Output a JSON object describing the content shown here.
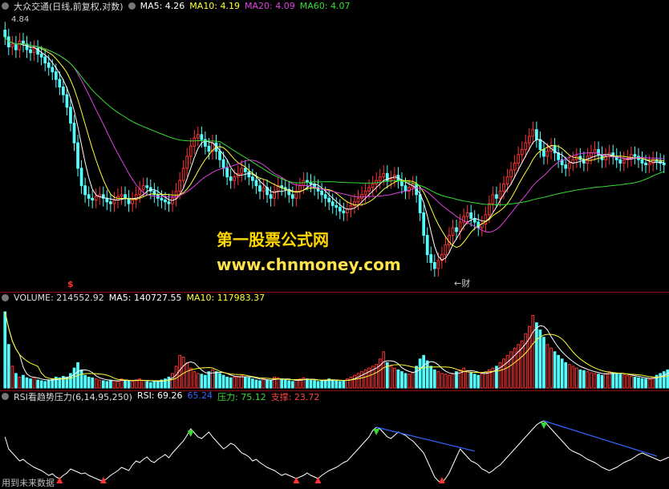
{
  "header": {
    "stock": "大众交通(日线,前复权,对数)",
    "ma": [
      {
        "text": "MA5: 4.26",
        "color": "#ffffff"
      },
      {
        "text": "MA10: 4.19",
        "color": "#ffff33"
      },
      {
        "text": "MA20: 4.09",
        "color": "#e040e0"
      },
      {
        "text": "MA60: 4.07",
        "color": "#33dd33"
      }
    ]
  },
  "volume_header": {
    "items": [
      {
        "text": "VOLUME: 214552.92",
        "color": "#dddddd"
      },
      {
        "text": "MA5: 140727.55",
        "color": "#ffffff"
      },
      {
        "text": "MA10: 117983.37",
        "color": "#ffff33"
      }
    ]
  },
  "rsi_header": {
    "items": [
      {
        "text": "RSI看趋势压力(6,14,95,250)",
        "color": "#dddddd"
      },
      {
        "text": "RSI: 69.26",
        "color": "#ffffff"
      },
      {
        "text": "65.24",
        "color": "#3366ff"
      },
      {
        "text": "压力: 75.12",
        "color": "#33dd33"
      },
      {
        "text": "支撑: 23.72",
        "color": "#ff4444"
      }
    ]
  },
  "annotations": {
    "high_label": "4.84",
    "marker_s": "$",
    "marker_cai": "←财",
    "future_note": "用到未来数据"
  },
  "watermark": {
    "line1": "第一股票公式网",
    "line2": "www.chnmoney.com"
  },
  "colors": {
    "up": "#ff3333",
    "down": "#54ffff",
    "ma5": "#ffffff",
    "ma10": "#ffff33",
    "ma20": "#e040e0",
    "ma60": "#33dd33",
    "rsi": "#ffffff",
    "rsi_trend": "#3366ff",
    "pressure": "#33dd33",
    "buy_arrow": "#ff3333",
    "sell_arrow": "#33dd33"
  },
  "chart_data": {
    "type": "candlestick",
    "price_range": [
      3.35,
      4.95
    ],
    "closes": [
      4.79,
      4.72,
      4.74,
      4.7,
      4.76,
      4.74,
      4.7,
      4.68,
      4.71,
      4.67,
      4.65,
      4.61,
      4.58,
      4.55,
      4.5,
      4.45,
      4.4,
      4.32,
      4.22,
      4.1,
      3.95,
      3.85,
      3.8,
      3.78,
      3.77,
      3.79,
      3.8,
      3.78,
      3.76,
      3.75,
      3.77,
      3.79,
      3.8,
      3.78,
      3.75,
      3.77,
      3.8,
      3.83,
      3.85,
      3.84,
      3.82,
      3.8,
      3.78,
      3.77,
      3.76,
      3.75,
      3.78,
      3.82,
      3.88,
      3.95,
      4.02,
      4.08,
      4.13,
      4.15,
      4.12,
      4.08,
      4.05,
      4.1,
      4.05,
      4.0,
      3.95,
      3.9,
      3.88,
      3.9,
      3.92,
      3.95,
      3.93,
      3.9,
      3.88,
      3.85,
      3.82,
      3.84,
      3.8,
      3.78,
      3.82,
      3.85,
      3.84,
      3.83,
      3.8,
      3.78,
      3.82,
      3.85,
      3.88,
      3.87,
      3.86,
      3.84,
      3.82,
      3.8,
      3.78,
      3.76,
      3.74,
      3.73,
      3.71,
      3.7,
      3.72,
      3.74,
      3.76,
      3.78,
      3.8,
      3.82,
      3.84,
      3.86,
      3.88,
      3.9,
      3.92,
      3.88,
      3.89,
      3.91,
      3.88,
      3.85,
      3.82,
      3.84,
      3.86,
      3.8,
      3.7,
      3.58,
      3.48,
      3.44,
      3.41,
      3.45,
      3.48,
      3.53,
      3.58,
      3.62,
      3.6,
      3.65,
      3.68,
      3.7,
      3.67,
      3.65,
      3.62,
      3.64,
      3.69,
      3.75,
      3.8,
      3.78,
      3.82,
      3.86,
      3.9,
      3.94,
      3.98,
      4.03,
      4.06,
      4.1,
      4.14,
      4.18,
      4.12,
      4.06,
      4.02,
      4.05,
      4.08,
      4.04,
      4.0,
      3.97,
      3.95,
      3.98,
      4.0,
      4.02,
      4.0,
      3.98,
      4.02,
      4.04,
      4.06,
      4.03,
      4.0,
      4.02,
      4.04,
      4.02,
      4.0,
      3.98,
      4.0,
      4.01,
      4.03,
      4.02,
      4.0,
      3.98,
      3.97,
      3.98,
      4.0,
      3.99,
      3.98,
      3.97
    ],
    "volume_range": [
      0,
      230000
    ],
    "volumes": [
      210000,
      120000,
      60000,
      40000,
      30000,
      35000,
      28000,
      25000,
      30000,
      22000,
      20000,
      18000,
      22000,
      25000,
      30000,
      28000,
      32000,
      30000,
      40000,
      55000,
      70000,
      50000,
      35000,
      30000,
      28000,
      25000,
      22000,
      20000,
      18000,
      22000,
      20000,
      18000,
      25000,
      22000,
      20000,
      18000,
      22000,
      25000,
      20000,
      18000,
      15000,
      18000,
      20000,
      22000,
      25000,
      30000,
      40000,
      60000,
      90000,
      85000,
      70000,
      55000,
      45000,
      40000,
      38000,
      35000,
      45000,
      50000,
      45000,
      40000,
      35000,
      30000,
      28000,
      30000,
      32000,
      35000,
      30000,
      28000,
      25000,
      22000,
      20000,
      25000,
      22000,
      20000,
      30000,
      28000,
      25000,
      22000,
      20000,
      18000,
      22000,
      25000,
      28000,
      25000,
      22000,
      20000,
      18000,
      20000,
      22000,
      25000,
      22000,
      20000,
      18000,
      20000,
      25000,
      30000,
      35000,
      40000,
      45000,
      50000,
      55000,
      60000,
      65000,
      80000,
      100000,
      70000,
      60000,
      55000,
      50000,
      45000,
      40000,
      38000,
      42000,
      60000,
      80000,
      90000,
      75000,
      60000,
      50000,
      45000,
      40000,
      38000,
      35000,
      40000,
      45000,
      50000,
      55000,
      48000,
      42000,
      38000,
      35000,
      40000,
      45000,
      50000,
      55000,
      60000,
      70000,
      80000,
      90000,
      100000,
      110000,
      120000,
      130000,
      150000,
      170000,
      200000,
      180000,
      160000,
      140000,
      120000,
      110000,
      100000,
      90000,
      80000,
      70000,
      65000,
      60000,
      55000,
      50000,
      48000,
      45000,
      42000,
      40000,
      38000,
      35000,
      40000,
      45000,
      42000,
      40000,
      38000,
      36000,
      34000,
      32000,
      30000,
      28000,
      26000,
      25000,
      24000,
      30000,
      35000,
      40000,
      45000,
      50000,
      55000
    ],
    "rsi_range": [
      0,
      100
    ],
    "rsi": [
      60,
      45,
      40,
      35,
      30,
      32,
      28,
      25,
      22,
      20,
      18,
      15,
      12,
      14,
      10,
      8,
      12,
      15,
      20,
      18,
      16,
      14,
      15,
      12,
      10,
      8,
      6,
      5,
      8,
      12,
      15,
      18,
      22,
      20,
      18,
      25,
      30,
      28,
      32,
      35,
      30,
      28,
      32,
      35,
      38,
      34,
      40,
      45,
      50,
      55,
      62,
      70,
      65,
      60,
      58,
      62,
      66,
      60,
      55,
      50,
      45,
      48,
      52,
      50,
      45,
      40,
      38,
      35,
      30,
      32,
      28,
      25,
      22,
      20,
      18,
      15,
      12,
      14,
      12,
      10,
      8,
      10,
      12,
      15,
      12,
      10,
      8,
      12,
      15,
      18,
      20,
      22,
      25,
      28,
      30,
      35,
      40,
      45,
      50,
      55,
      60,
      68,
      72,
      70,
      65,
      60,
      58,
      62,
      66,
      64,
      62,
      58,
      55,
      50,
      45,
      40,
      30,
      20,
      10,
      5,
      3,
      8,
      15,
      25,
      35,
      45,
      40,
      35,
      30,
      28,
      25,
      20,
      18,
      15,
      18,
      22,
      25,
      30,
      35,
      40,
      45,
      50,
      55,
      60,
      65,
      70,
      75,
      78,
      80,
      75,
      70,
      65,
      60,
      55,
      50,
      45,
      42,
      40,
      38,
      35,
      32,
      30,
      28,
      25,
      22,
      20,
      18,
      20,
      22,
      25,
      28,
      30,
      32,
      35,
      38,
      40,
      38,
      36,
      34,
      32,
      30,
      32,
      34,
      36,
      38,
      40,
      42
    ]
  }
}
